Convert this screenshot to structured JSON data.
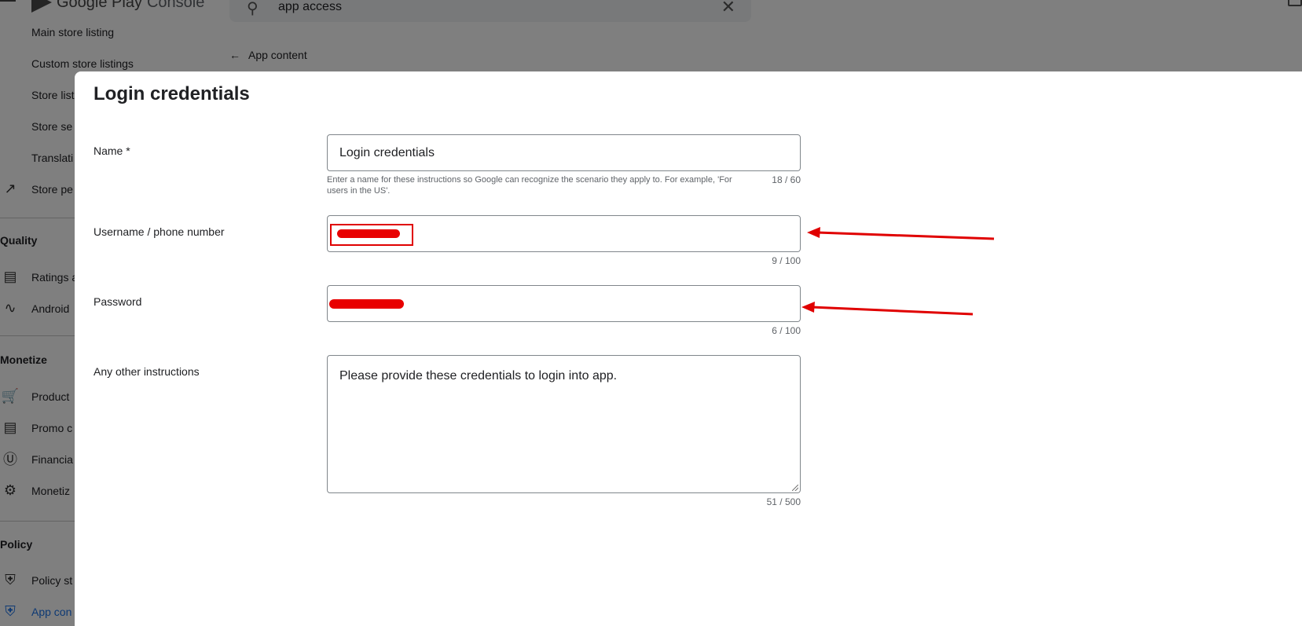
{
  "header": {
    "app_name_prefix": "Google Play",
    "app_name_suffix": "Console",
    "search_value": "app access"
  },
  "sidebar": {
    "items_top": [
      {
        "label": "Main store listing"
      },
      {
        "label": "Custom store listings"
      },
      {
        "label": "Store list"
      },
      {
        "label": "Store se"
      },
      {
        "label": "Translati"
      },
      {
        "label": "Store pe"
      }
    ],
    "quality": {
      "title": "Quality",
      "items": [
        {
          "label": "Ratings a"
        },
        {
          "label": "Android"
        }
      ]
    },
    "monetize": {
      "title": "Monetize",
      "items": [
        {
          "label": "Product"
        },
        {
          "label": "Promo c"
        },
        {
          "label": "Financia"
        },
        {
          "label": "Monetiz"
        }
      ]
    },
    "policy": {
      "title": "Policy",
      "items": [
        {
          "label": "Policy st"
        },
        {
          "label": "App con"
        }
      ]
    }
  },
  "breadcrumb": {
    "back_label": "App content"
  },
  "dialog": {
    "title": "Login credentials",
    "name_field": {
      "label": "Name  *",
      "value": "Login credentials",
      "helper": "Enter a name for these instructions so Google can recognize the scenario they apply to. For example, 'For users in the US'.",
      "counter": "18 / 60"
    },
    "username_field": {
      "label": "Username / phone number",
      "counter": "9 / 100"
    },
    "password_field": {
      "label": "Password",
      "counter": "6 / 100"
    },
    "instructions_field": {
      "label": "Any other instructions",
      "value": "Please provide these credentials to login into app.",
      "counter": "51 / 500"
    }
  },
  "annotations": {
    "color": "#e00000"
  }
}
